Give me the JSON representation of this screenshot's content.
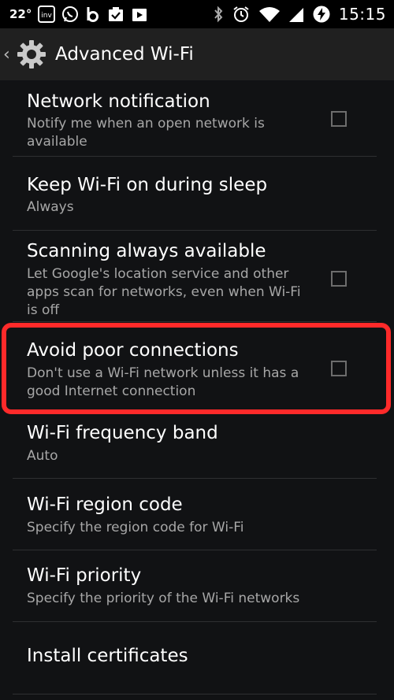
{
  "statusbar": {
    "temperature": "22°",
    "time": "15:15",
    "left_icons": [
      "temperature",
      "inv-app-icon",
      "whatsapp-icon",
      "b-app-icon",
      "task-icon",
      "play-store-icon"
    ],
    "right_icons": [
      "bluetooth-icon",
      "alarm-icon",
      "wifi-icon",
      "signal-icon",
      "battery-charging-icon"
    ]
  },
  "actionbar": {
    "title": "Advanced Wi-Fi",
    "icon": "settings-gear-icon"
  },
  "items": [
    {
      "title": "Network notification",
      "summary": "Notify me when an open network is available",
      "has_checkbox": true,
      "checked": false
    },
    {
      "title": "Keep Wi-Fi on during sleep",
      "summary": "Always",
      "has_checkbox": false
    },
    {
      "title": "Scanning always available",
      "summary": "Let Google's location service and other apps scan for networks, even when Wi-Fi is off",
      "has_checkbox": true,
      "checked": false
    },
    {
      "title": "Avoid poor connections",
      "summary": "Don't use a Wi-Fi network unless it has a good Internet connection",
      "has_checkbox": true,
      "checked": false
    },
    {
      "title": "Wi-Fi frequency band",
      "summary": "Auto",
      "has_checkbox": false
    },
    {
      "title": "Wi-Fi region code",
      "summary": "Specify the region code for Wi-Fi",
      "has_checkbox": false
    },
    {
      "title": "Wi-Fi priority",
      "summary": "Specify the priority of the Wi-Fi networks",
      "has_checkbox": false
    },
    {
      "title": "Install certificates",
      "summary": "",
      "has_checkbox": false
    }
  ],
  "highlight_color": "#ff2a2a",
  "background_color": "#111214"
}
